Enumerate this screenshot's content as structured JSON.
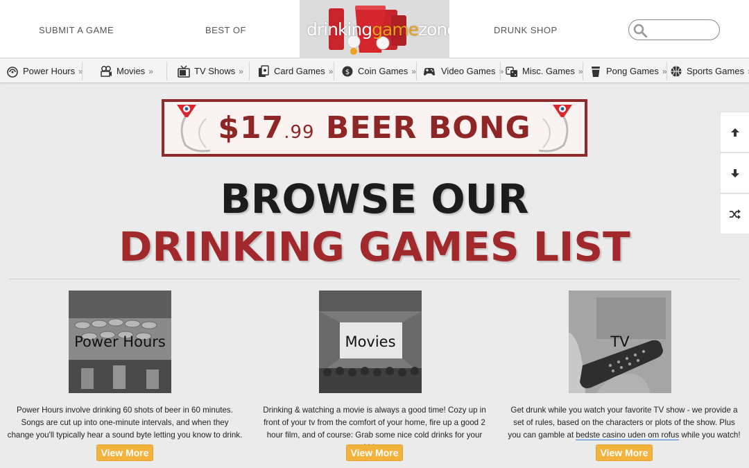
{
  "header": {
    "nav_left": [
      "SUBMIT A GAME",
      "BEST OF"
    ],
    "logo": {
      "part1": "drinking",
      "part2": "game",
      "part3": "zone"
    },
    "nav_right": "DRUNK SHOP",
    "search": {
      "placeholder": "",
      "value": "",
      "icon": "search-icon"
    }
  },
  "categories": [
    {
      "label": "Power Hours",
      "icon": "power-hour-icon"
    },
    {
      "label": "Movies",
      "icon": "projector-icon"
    },
    {
      "label": "TV Shows",
      "icon": "tv-icon"
    },
    {
      "label": "Card Games",
      "icon": "cards-icon"
    },
    {
      "label": "Coin Games",
      "icon": "coin-icon"
    },
    {
      "label": "Video Games",
      "icon": "gamepad-icon"
    },
    {
      "label": "Misc. Games",
      "icon": "dice-icon"
    },
    {
      "label": "Pong Games",
      "icon": "cup-icon"
    },
    {
      "label": "Sports Games",
      "icon": "ball-icon"
    }
  ],
  "category_suffix": "»",
  "banner": {
    "dollars": "$17",
    "cents": ".99",
    "product": "BEER BONG"
  },
  "side_buttons": [
    "arrow-up-icon",
    "arrow-down-icon",
    "shuffle-icon"
  ],
  "headline": {
    "line1": "BROWSE OUR",
    "line2": "DRINKING GAMES LIST"
  },
  "cards": [
    {
      "title": "Power Hours",
      "description": "Power Hours involve drinking 60 shots of beer in 60 minutes. Songs are cut up into one-minute intervals, and when they change you'll typically hear a sound byte letting you know to drink.",
      "button": "View More"
    },
    {
      "title": "Movies",
      "description": "Drinking & watching a movie is always a good time! Cozy up in front of your tv from the comfort of your home, fire up a good 2 hour film, and of course: Grab some nice cold drinks for your fridge.",
      "button": "View More"
    },
    {
      "title": "TV",
      "description_before": "Get drunk while you watch your favorite TV show - we provide a set of rules, based on the characters or plots of the show. Plus you can gamble at ",
      "link": "bedste casino uden om rofus",
      "description_after": " while you watch!",
      "button": "View More"
    }
  ],
  "colors": {
    "brand_red": "#a1282b",
    "accent_orange": "#f3b23c",
    "logo_orange": "#e8a21a"
  }
}
